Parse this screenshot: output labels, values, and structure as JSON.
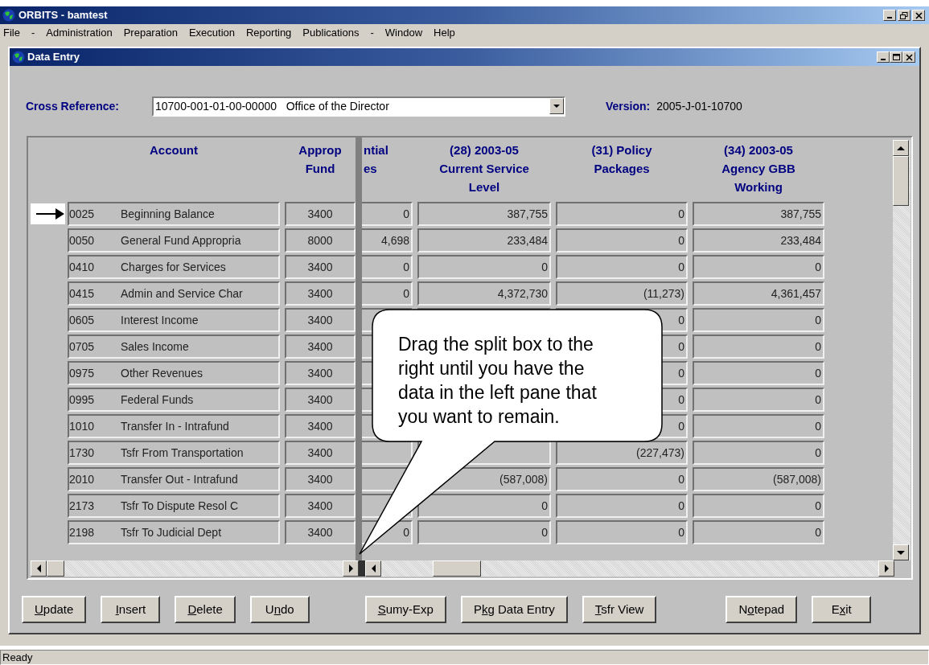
{
  "app_window": {
    "title": "ORBITS - bamtest"
  },
  "menu": [
    "File",
    "-",
    "Administration",
    "Preparation",
    "Execution",
    "Reporting",
    "Publications",
    "-",
    "Window",
    "Help"
  ],
  "child_window": {
    "title": "Data Entry"
  },
  "cross_reference": {
    "label": "Cross Reference:",
    "value": "10700-001-01-00-00000   Office of the Director"
  },
  "version": {
    "label": "Version:",
    "value": "2005-J-01-10700"
  },
  "table": {
    "columns": [
      {
        "lines": [
          "Account"
        ]
      },
      {
        "lines": [
          "Approp",
          "Fund"
        ]
      },
      {
        "lines": [
          "ntial",
          "es"
        ]
      },
      {
        "lines": [
          "(28) 2003-05",
          "Current Service",
          "Level"
        ]
      },
      {
        "lines": [
          "(31) Policy",
          "Packages"
        ]
      },
      {
        "lines": [
          "(34) 2003-05",
          "Agency GBB",
          "Working"
        ]
      }
    ],
    "rows": [
      {
        "code": "0025",
        "name": "Beginning Balance",
        "fund": "3400",
        "column_3": "0",
        "column_4": "387,755",
        "column_5": "0",
        "column_6": "387,755",
        "selected": true
      },
      {
        "code": "0050",
        "name": "General Fund Appropria",
        "fund": "8000",
        "column_3": "4,698",
        "column_4": "233,484",
        "column_5": "0",
        "column_6": "233,484",
        "selected": false
      },
      {
        "code": "0410",
        "name": "Charges for Services",
        "fund": "3400",
        "column_3": "0",
        "column_4": "0",
        "column_5": "0",
        "column_6": "0",
        "selected": false
      },
      {
        "code": "0415",
        "name": "Admin and Service Char",
        "fund": "3400",
        "column_3": "0",
        "column_4": "4,372,730",
        "column_5": "(11,273)",
        "column_6": "4,361,457",
        "selected": false
      },
      {
        "code": "0605",
        "name": "Interest Income",
        "fund": "3400",
        "column_5": "0",
        "column_6": "0",
        "selected": false
      },
      {
        "code": "0705",
        "name": "Sales Income",
        "fund": "3400",
        "column_5": "0",
        "column_6": "0",
        "selected": false
      },
      {
        "code": "0975",
        "name": "Other Revenues",
        "fund": "3400",
        "column_5": "0",
        "column_6": "0",
        "selected": false
      },
      {
        "code": "0995",
        "name": "Federal Funds",
        "fund": "3400",
        "column_5": "0",
        "column_6": "0",
        "selected": false
      },
      {
        "code": "1010",
        "name": "Transfer In - Intrafund",
        "fund": "3400",
        "column_5": "0",
        "column_6": "0",
        "selected": false
      },
      {
        "code": "1730",
        "name": "Tsfr From Transportation",
        "fund": "3400",
        "column_5": "(227,473)",
        "column_6": "0",
        "selected": false
      },
      {
        "code": "2010",
        "name": "Transfer Out - Intrafund",
        "fund": "3400",
        "column_4": "(587,008)",
        "column_5": "0",
        "column_6": "(587,008)",
        "selected": false
      },
      {
        "code": "2173",
        "name": "Tsfr To Dispute Resol C",
        "fund": "3400",
        "column_4": "0",
        "column_5": "0",
        "column_6": "0",
        "selected": false
      },
      {
        "code": "2198",
        "name": "Tsfr To Judicial Dept",
        "fund": "3400",
        "column_3": "0",
        "column_4": "0",
        "column_5": "0",
        "column_6": "0",
        "selected": false
      }
    ]
  },
  "callout": {
    "text": "Drag the split box to the right until you have the data in the left pane that you want to remain."
  },
  "button_groups": [
    [
      {
        "key": "U",
        "after": "pdate"
      },
      {
        "key": "I",
        "after": "nsert"
      },
      {
        "key": "D",
        "after": "elete"
      },
      {
        "before": "U",
        "key": "n",
        "after": "do"
      }
    ],
    [
      {
        "key": "S",
        "after": "umy-Exp"
      },
      {
        "before": "P",
        "key": "k",
        "after": "g Data Entry"
      },
      {
        "key": "T",
        "after": "sfr View"
      }
    ],
    [
      {
        "before": "N",
        "key": "o",
        "after": "tepad"
      },
      {
        "before": "E",
        "key": "x",
        "after": "it"
      }
    ]
  ],
  "status_bar": {
    "text": "Ready"
  }
}
